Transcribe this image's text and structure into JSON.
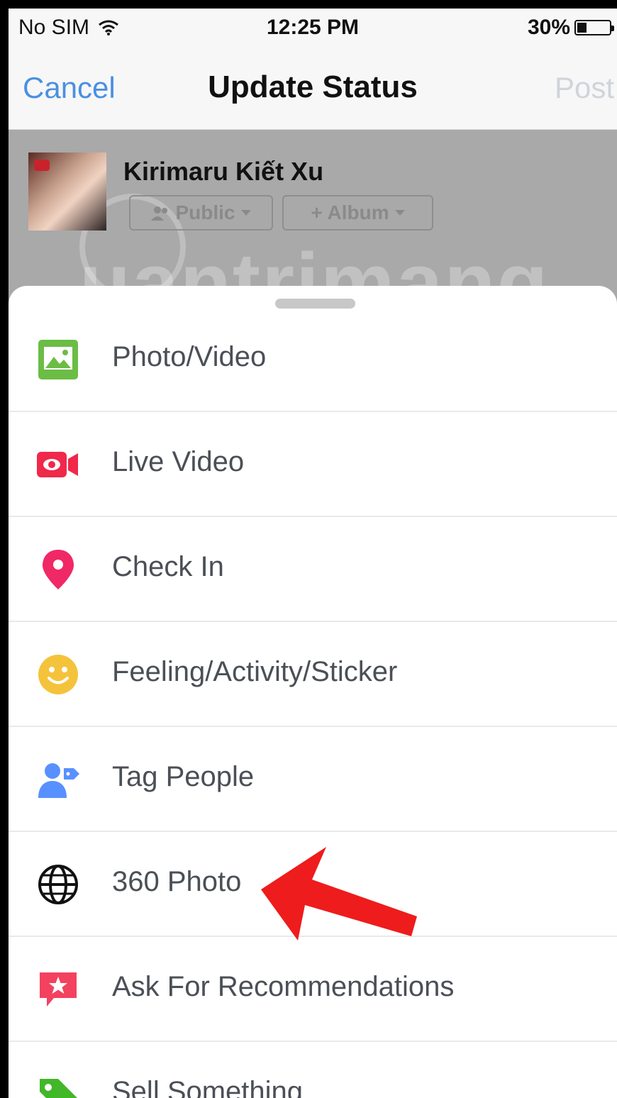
{
  "status_bar": {
    "carrier": "No SIM",
    "time": "12:25 PM",
    "battery_text": "30%",
    "battery_level": 0.3
  },
  "nav": {
    "cancel": "Cancel",
    "title": "Update Status",
    "post": "Post"
  },
  "composer": {
    "user_name": "Kirimaru Kiết Xu",
    "audience": "Public",
    "album": "+ Album",
    "watermark": "uantrimang"
  },
  "options": [
    {
      "label": "Photo/Video",
      "icon": "photo-video-icon",
      "color": "#6bbd45"
    },
    {
      "label": "Live Video",
      "icon": "live-video-icon",
      "color": "#f0284a"
    },
    {
      "label": "Check In",
      "icon": "check-in-pin-icon",
      "color": "#f02866"
    },
    {
      "label": "Feeling/Activity/Sticker",
      "icon": "smiley-icon",
      "color": "#f5c33b"
    },
    {
      "label": "Tag People",
      "icon": "tag-people-icon",
      "color": "#5890ff"
    },
    {
      "label": "360 Photo",
      "icon": "globe-icon",
      "color": "#111111"
    },
    {
      "label": "Ask For Recommendations",
      "icon": "recommendation-star-icon",
      "color": "#f3425f"
    },
    {
      "label": "Sell Something",
      "icon": "sell-tag-icon",
      "color": "#42b72a"
    }
  ]
}
